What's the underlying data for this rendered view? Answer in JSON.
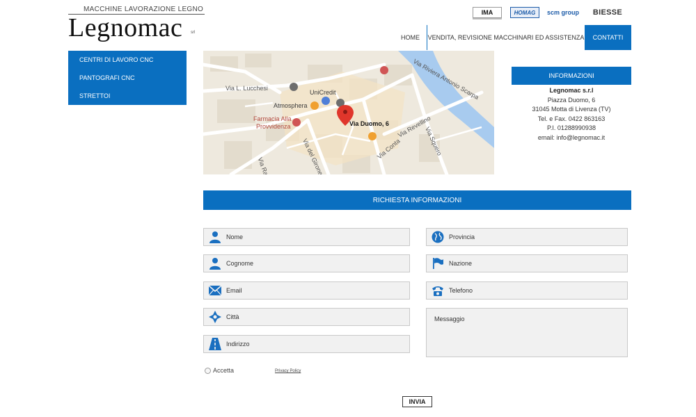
{
  "brand": {
    "tagline": "MACCHINE LAVORAZIONE LEGNO",
    "name": "Legnomac",
    "suffix": "srl"
  },
  "partner_logos": [
    "IMA",
    "HOMAG",
    "scm group",
    "BIESSE"
  ],
  "nav": {
    "home": "HOME",
    "vendita": "VENDITA, REVISIONE MACCHINARI ED ASSISTENZA",
    "contatti": "CONTATTI"
  },
  "sidebar": {
    "items": [
      {
        "label": "CENTRI DI LAVORO CNC"
      },
      {
        "label": "PANTOGRAFI CNC"
      },
      {
        "label": "STRETTOI"
      }
    ]
  },
  "map": {
    "labels": {
      "via_lucchesi": "Via L. Lucchesi",
      "unicredit": "UniCredit",
      "atmosphera": "Atmosphera",
      "farmacia1": "Farmacia Alla",
      "farmacia2": "Provvidenza",
      "via_girone": "Via del Girone",
      "marker": "Via Duomo, 6",
      "via_revellino": "Via Revellino",
      "via_squero": "Via Squero",
      "via_riviera": "Via Riviera Antonio Scarpa",
      "via_contarini": "Via Conta",
      "via_ra": "Via Ra"
    }
  },
  "info": {
    "title": "INFORMAZIONI",
    "company": "Legnomac s.r.l",
    "address1": "Piazza Duomo, 6",
    "address2": "31045 Motta di Livenza (TV)",
    "phone": "Tel. e Fax. 0422 863163",
    "vat": "P.I. 01288990938",
    "email": "email: info@legnomac.it"
  },
  "form": {
    "title": "RICHIESTA INFORMAZIONI",
    "fields": {
      "nome": "Nome",
      "cognome": "Cognome",
      "email": "Email",
      "citta": "Città",
      "indirizzo": "Indirizzo",
      "provincia": "Provincia",
      "nazione": "Nazione",
      "telefono": "Telefono",
      "messaggio": "Messaggio"
    },
    "accept_label": "Accetta",
    "privacy_label": "Privacy Policy",
    "submit_label": "INVIA"
  },
  "colors": {
    "accent": "#0a6fc0",
    "field_bg": "#f1f1f1",
    "icon": "#1a6fc0",
    "map_water": "#a8cbef",
    "map_marker": "#e0362b"
  }
}
